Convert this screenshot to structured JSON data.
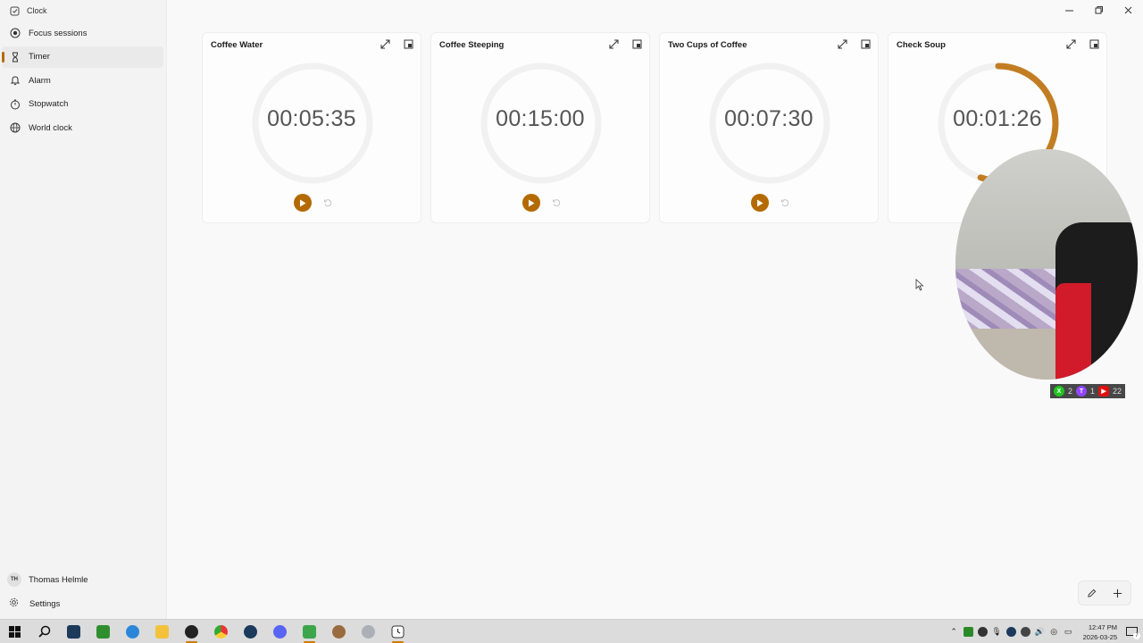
{
  "app": {
    "title": "Clock"
  },
  "nav": [
    {
      "label": "Focus sessions",
      "icon": "focus-icon"
    },
    {
      "label": "Timer",
      "icon": "hourglass-icon",
      "active": true
    },
    {
      "label": "Alarm",
      "icon": "bell-icon"
    },
    {
      "label": "Stopwatch",
      "icon": "stopwatch-icon"
    },
    {
      "label": "World clock",
      "icon": "globe-icon"
    }
  ],
  "user": {
    "initials": "TH",
    "name": "Thomas Helmle"
  },
  "settings_label": "Settings",
  "timers": [
    {
      "title": "Coffee Water",
      "time": "00:05:35",
      "progress": 0
    },
    {
      "title": "Coffee Steeping",
      "time": "00:15:00",
      "progress": 0
    },
    {
      "title": "Two Cups of Coffee",
      "time": "00:07:30",
      "progress": 0
    },
    {
      "title": "Check Soup",
      "time": "00:01:26",
      "progress": 0.55
    }
  ],
  "stream_badges": [
    {
      "platform": "xbox",
      "count": "2",
      "color": "#21c521"
    },
    {
      "platform": "twitch",
      "count": "1",
      "color": "#9146ff"
    },
    {
      "platform": "youtube",
      "count": "22",
      "color": "#e01010"
    }
  ],
  "taskbar": {
    "time": "12:47 PM",
    "date": "2026-03-25",
    "notifications": "7"
  },
  "colors": {
    "accent": "#b36a00",
    "ring_track": "#f1f1f1",
    "ring_progress": "#c27d23"
  }
}
